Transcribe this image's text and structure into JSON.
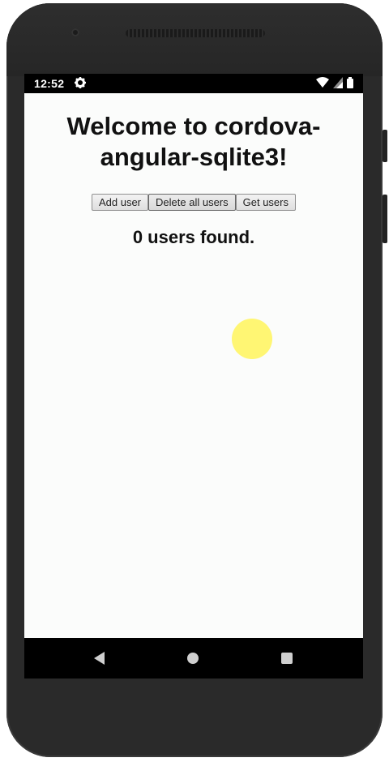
{
  "status_bar": {
    "time": "12:52",
    "icons": [
      "gear-icon",
      "wifi-icon",
      "signal-icon",
      "battery-icon"
    ]
  },
  "app": {
    "title": "Welcome to cordova-angular-sqlite3!",
    "buttons": {
      "add": "Add user",
      "delete_all": "Delete all users",
      "get": "Get users"
    },
    "count_text": "0 users found."
  },
  "nav_bar": {
    "icons": [
      "back-icon",
      "home-icon",
      "recents-icon"
    ]
  },
  "colors": {
    "screen_bg": "#fbfcfb",
    "touch_indicator": "#fff45a",
    "device_frame": "#2a2a2a"
  }
}
